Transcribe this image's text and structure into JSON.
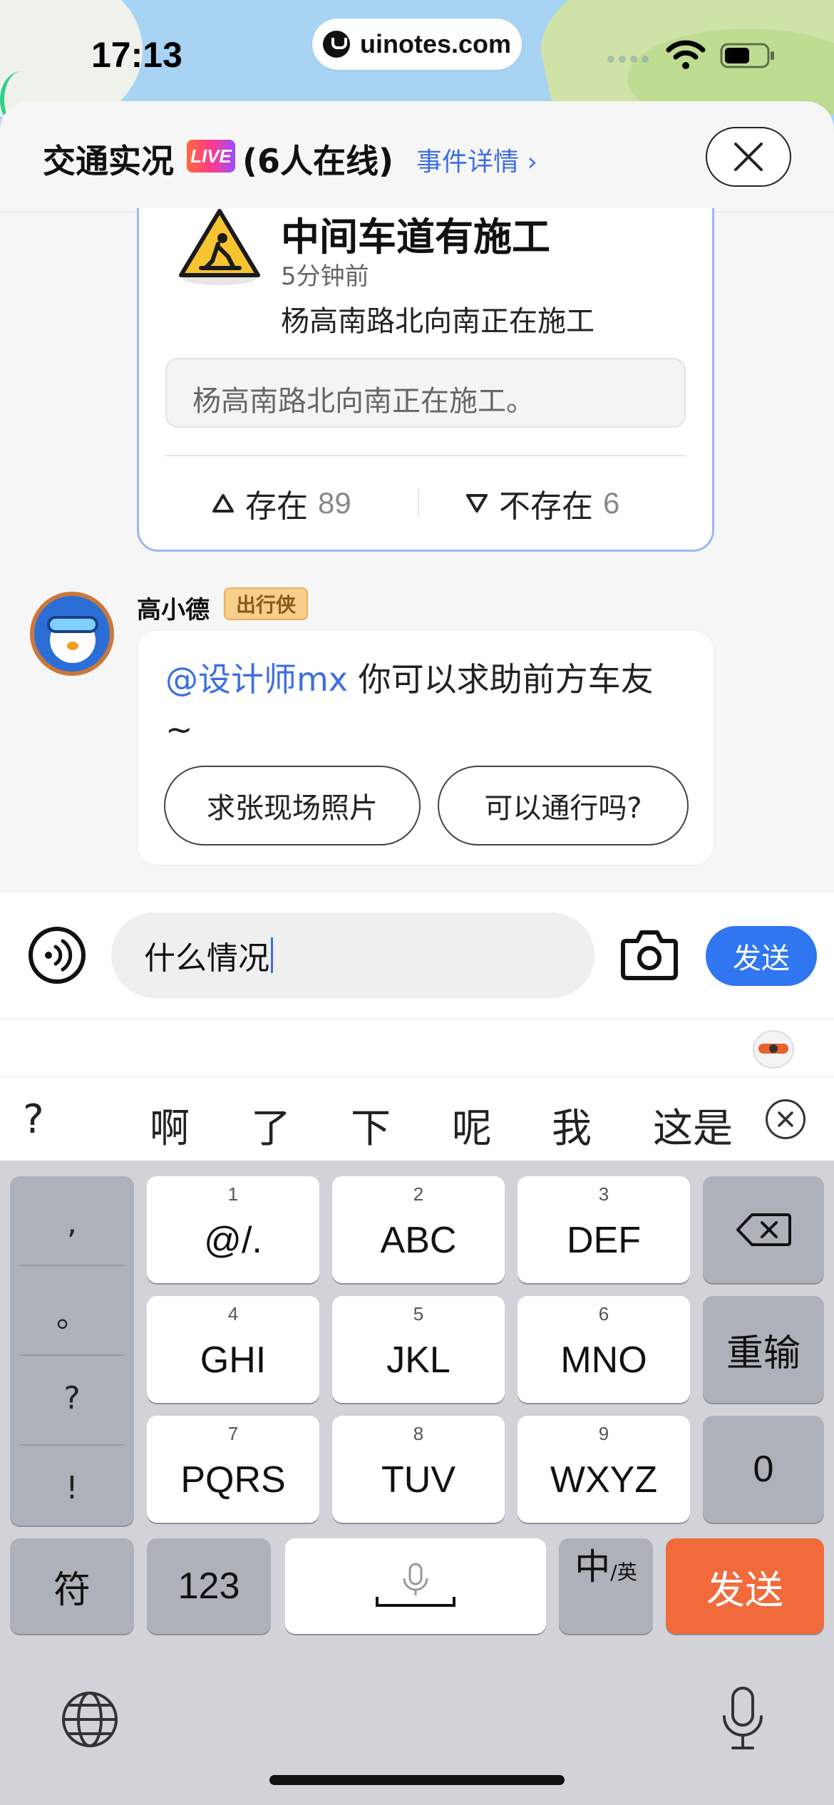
{
  "status_bar": {
    "time": "17:13",
    "url": "uinotes.com"
  },
  "header": {
    "title": "交通实况",
    "live_badge": "LIVE",
    "online_count": "(6人在线)",
    "event_detail": "事件详情 ›"
  },
  "event_card": {
    "title": "中间车道有施工",
    "time": "5分钟前",
    "description": "杨高南路北向南正在施工",
    "quote": "杨高南路北向南正在施工。",
    "exist_label": "存在",
    "exist_count": "89",
    "not_exist_label": "不存在",
    "not_exist_count": "6"
  },
  "bot": {
    "name": "高小德",
    "badge": "出行侠",
    "mention": "@设计师mx",
    "message_line1": " 你可以求助前方车友",
    "message_line2": "~",
    "quick_replies": [
      "求张现场照片",
      "可以通行吗?"
    ]
  },
  "input": {
    "value": "什么情况",
    "send_label": "发送"
  },
  "candidates": [
    "?",
    "啊",
    "了",
    "下",
    "呢",
    "我",
    "这是"
  ],
  "keyboard": {
    "punctuation": [
      ",",
      "。",
      "?",
      "!"
    ],
    "keys": [
      {
        "num": "1",
        "letters": "@/."
      },
      {
        "num": "2",
        "letters": "ABC"
      },
      {
        "num": "3",
        "letters": "DEF"
      },
      {
        "num": "4",
        "letters": "GHI"
      },
      {
        "num": "5",
        "letters": "JKL"
      },
      {
        "num": "6",
        "letters": "MNO"
      },
      {
        "num": "7",
        "letters": "PQRS"
      },
      {
        "num": "8",
        "letters": "TUV"
      },
      {
        "num": "9",
        "letters": "WXYZ"
      }
    ],
    "reenter": "重输",
    "zero": "0",
    "symbols": "符",
    "numbers": "123",
    "lang_main": "中",
    "lang_sub": "/英",
    "send": "发送"
  }
}
